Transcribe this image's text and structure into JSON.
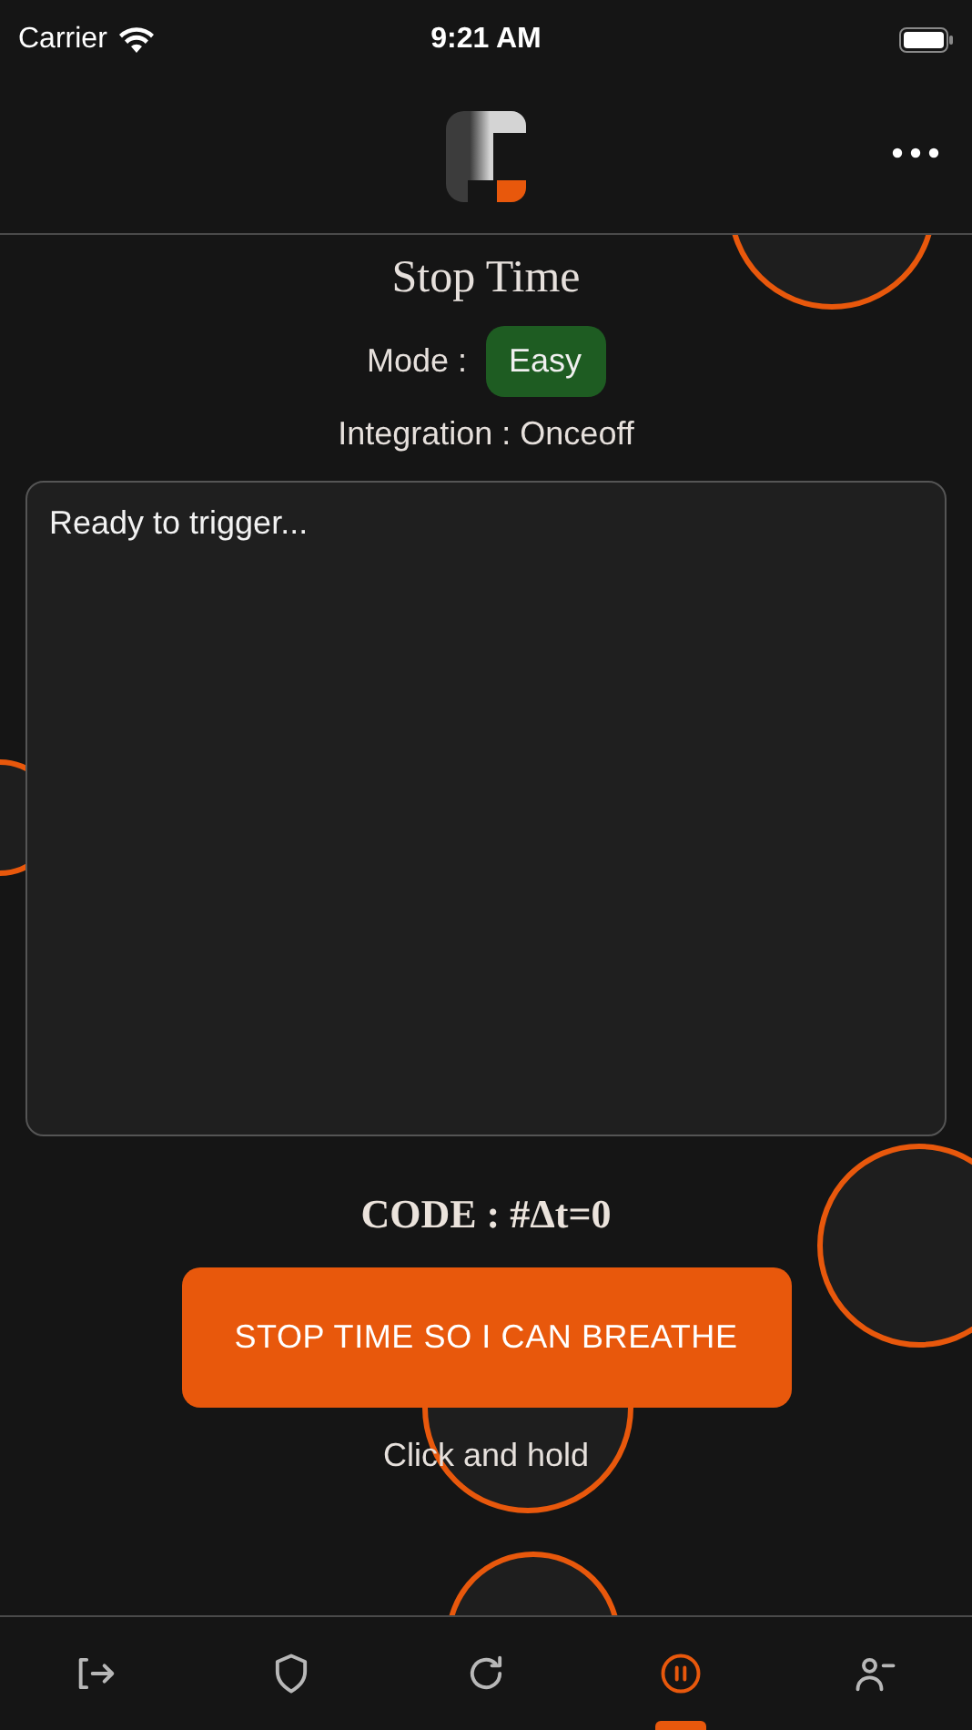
{
  "status_bar": {
    "carrier": "Carrier",
    "time": "9:21 AM"
  },
  "title": "Stop Time",
  "mode": {
    "label": "Mode :",
    "value": "Easy"
  },
  "integration": "Integration : Onceoff",
  "output": {
    "value": "Ready to trigger..."
  },
  "code": "CODE : #Δt=0",
  "action_button": "STOP TIME SO I CAN BREATHE",
  "hint": "Click and hold",
  "nav_tabs": [
    {
      "kind": "exit",
      "selected": false
    },
    {
      "kind": "shield",
      "selected": false
    },
    {
      "kind": "refresh",
      "selected": false
    },
    {
      "kind": "pause",
      "selected": true
    },
    {
      "kind": "user-remove",
      "selected": false
    }
  ]
}
